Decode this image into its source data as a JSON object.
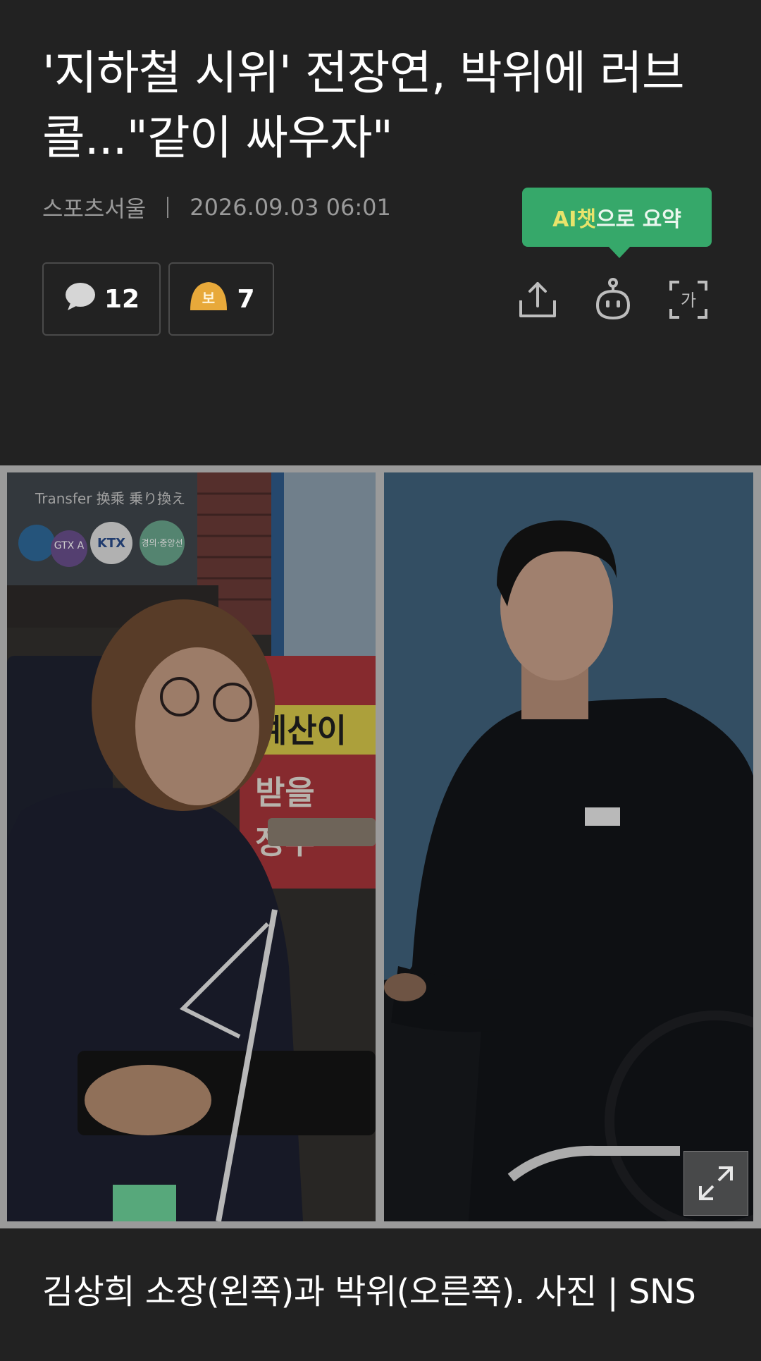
{
  "article": {
    "title": "'지하철 시위' 전장연, 박위에 러브콜...\"같이 싸우자\"",
    "source": "스포츠서울",
    "date": "2026.09.03 06:01"
  },
  "ai_summary": {
    "label_highlight": "AI챗",
    "label_rest": "으로 요약"
  },
  "reactions": {
    "comments_count": "12",
    "reaction_count": "7",
    "reaction_icon_char": "보"
  },
  "photo": {
    "sign_text": "예산이",
    "sign_text_2": "받을",
    "sign_text_3": "정부",
    "station_sign": "Transfer  换乘  乗り換え",
    "line_badges": [
      "GTX A",
      "KTX",
      "경의·중앙선"
    ],
    "caption": "김상희 소장(왼쪽)과 박위(오른쪽). 사진 | SNS"
  },
  "icons": {
    "comment": "comment-bubble-icon",
    "reaction": "reaction-emoji-icon",
    "share": "share-icon",
    "bot": "ai-bot-icon",
    "font": "font-size-icon",
    "expand": "expand-icon"
  },
  "colors": {
    "background": "#222222",
    "ai_badge": "#36a86a",
    "ai_badge_highlight": "#e8e36b",
    "meta_text": "#9a9a9a"
  }
}
